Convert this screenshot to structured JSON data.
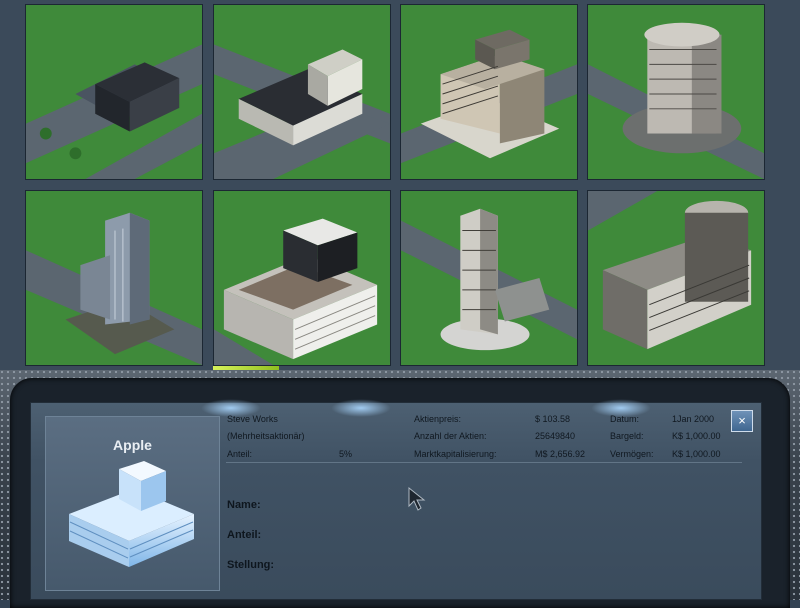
{
  "company": {
    "name": "Apple"
  },
  "holder": {
    "name": "Steve Works",
    "role": "(Mehrheitsaktionär)"
  },
  "stats": {
    "share_label": "Anteil:",
    "share_value": "5%",
    "price_label": "Aktienpreis:",
    "price_value": "$ 103.58",
    "shares_label": "Anzahl der Aktien:",
    "shares_value": "25649840",
    "cap_label": "Marktkapitalisierung:",
    "cap_value": "M$ 2,656.92",
    "date_label": "Datum:",
    "date_value": "1Jan 2000",
    "cash_label": "Bargeld:",
    "cash_value": "K$ 1,000.00",
    "assets_label": "Vermögen:",
    "assets_value": "K$ 1,000.00"
  },
  "detail": {
    "name_label": "Name:",
    "share_label": "Anteil:",
    "position_label": "Stellung:"
  },
  "buttons": {
    "close": "×"
  },
  "colors": {
    "grass": "#3f8a3a",
    "road": "#5b6670",
    "accent": "#b9e23a",
    "panel": "#405264"
  }
}
